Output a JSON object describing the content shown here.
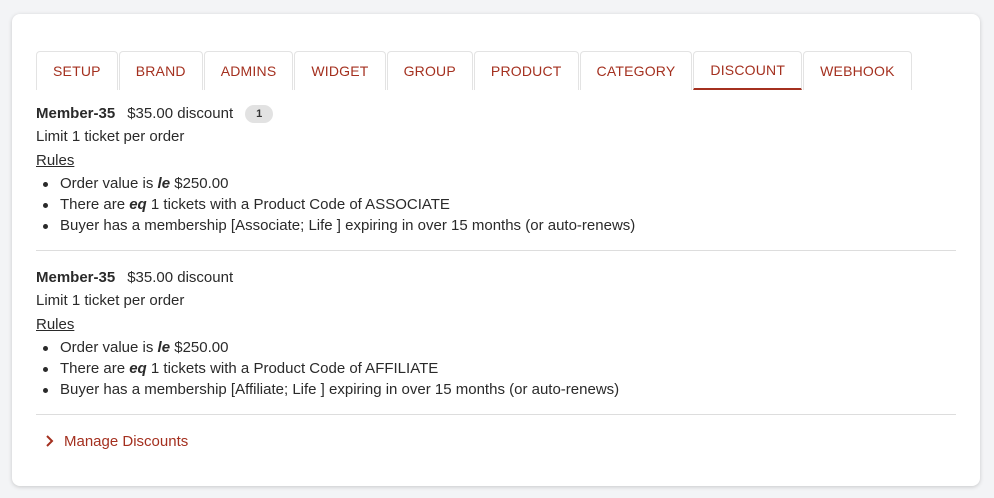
{
  "tabs": [
    {
      "label": "SETUP"
    },
    {
      "label": "BRAND"
    },
    {
      "label": "ADMINS"
    },
    {
      "label": "WIDGET"
    },
    {
      "label": "GROUP"
    },
    {
      "label": "PRODUCT"
    },
    {
      "label": "CATEGORY"
    },
    {
      "label": "DISCOUNT",
      "active": true
    },
    {
      "label": "WEBHOOK"
    }
  ],
  "discounts": [
    {
      "name": "Member-35",
      "amount": "$35.00 discount",
      "badge": "1",
      "limit": "Limit 1 ticket per order",
      "rules_title": "Rules",
      "rules": [
        {
          "pre": "Order value is",
          "op": "le",
          "post": "$250.00"
        },
        {
          "pre": "There are",
          "op": "eq",
          "post": "1 tickets with a Product Code of ASSOCIATE"
        },
        {
          "text": "Buyer has a membership [Associate; Life ] expiring in over 15 months (or auto-renews)"
        }
      ]
    },
    {
      "name": "Member-35",
      "amount": "$35.00 discount",
      "limit": "Limit 1 ticket per order",
      "rules_title": "Rules",
      "rules": [
        {
          "pre": "Order value is",
          "op": "le",
          "post": "$250.00"
        },
        {
          "pre": "There are",
          "op": "eq",
          "post": "1 tickets with a Product Code of AFFILIATE"
        },
        {
          "text": "Buyer has a membership [Affiliate; Life ] expiring in over 15 months (or auto-renews)"
        }
      ]
    }
  ],
  "manage": {
    "label": "Manage Discounts",
    "icon": "chevron-right-icon"
  },
  "colors": {
    "accent": "#a4301f",
    "background": "#f3f4f6",
    "badge": "#e2e2e2"
  }
}
